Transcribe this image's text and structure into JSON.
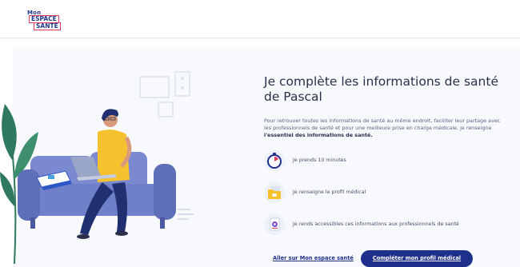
{
  "logo": {
    "line1": "Mon",
    "line2": "ESPACE",
    "line3": "SANTÉ"
  },
  "main": {
    "title": "Je complète les informations de santé de Pascal",
    "description_intro": "Pour retrouver toutes les informations de santé au même endroit, faciliter leur partage avec les professionnels de santé et pour une meilleure prise en charge médicale, je renseigne ",
    "description_bold": "l'essentiel des informations de santé.",
    "steps": [
      {
        "label": "Je prends 10 minutes",
        "icon": "stopwatch-icon"
      },
      {
        "label": "Je renseigne le profil médical",
        "icon": "medical-folder-icon"
      },
      {
        "label": "Je rends accessibles ces informations aux professionnels de santé",
        "icon": "share-document-icon"
      }
    ],
    "link_label": "Aller sur Mon espace santé",
    "button_label": "Compléter mon profil médical"
  },
  "colors": {
    "brand_blue": "#1e2f8c",
    "brand_pink": "#e23a5e",
    "accent_yellow": "#f5c12e",
    "sofa": "#6f7fc9",
    "plant": "#2f7a5e"
  }
}
